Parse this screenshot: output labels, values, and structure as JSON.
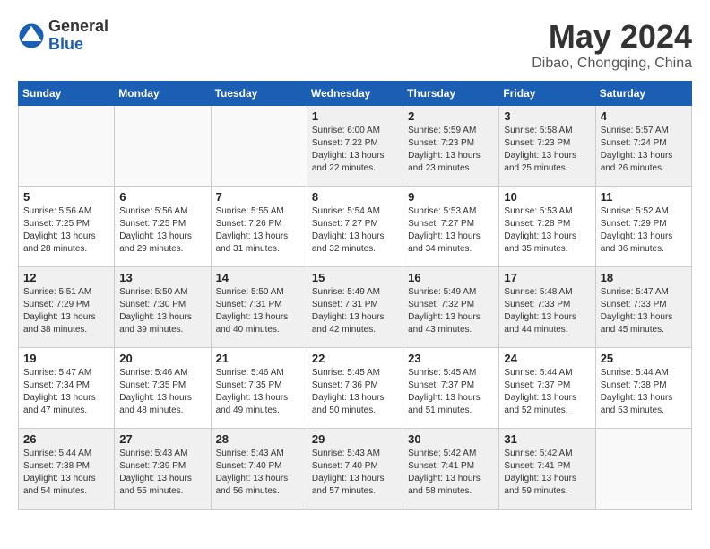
{
  "header": {
    "logo_general": "General",
    "logo_blue": "Blue",
    "month_year": "May 2024",
    "location": "Dibao, Chongqing, China"
  },
  "weekdays": [
    "Sunday",
    "Monday",
    "Tuesday",
    "Wednesday",
    "Thursday",
    "Friday",
    "Saturday"
  ],
  "weeks": [
    [
      {
        "day": "",
        "info": ""
      },
      {
        "day": "",
        "info": ""
      },
      {
        "day": "",
        "info": ""
      },
      {
        "day": "1",
        "info": "Sunrise: 6:00 AM\nSunset: 7:22 PM\nDaylight: 13 hours\nand 22 minutes."
      },
      {
        "day": "2",
        "info": "Sunrise: 5:59 AM\nSunset: 7:23 PM\nDaylight: 13 hours\nand 23 minutes."
      },
      {
        "day": "3",
        "info": "Sunrise: 5:58 AM\nSunset: 7:23 PM\nDaylight: 13 hours\nand 25 minutes."
      },
      {
        "day": "4",
        "info": "Sunrise: 5:57 AM\nSunset: 7:24 PM\nDaylight: 13 hours\nand 26 minutes."
      }
    ],
    [
      {
        "day": "5",
        "info": "Sunrise: 5:56 AM\nSunset: 7:25 PM\nDaylight: 13 hours\nand 28 minutes."
      },
      {
        "day": "6",
        "info": "Sunrise: 5:56 AM\nSunset: 7:25 PM\nDaylight: 13 hours\nand 29 minutes."
      },
      {
        "day": "7",
        "info": "Sunrise: 5:55 AM\nSunset: 7:26 PM\nDaylight: 13 hours\nand 31 minutes."
      },
      {
        "day": "8",
        "info": "Sunrise: 5:54 AM\nSunset: 7:27 PM\nDaylight: 13 hours\nand 32 minutes."
      },
      {
        "day": "9",
        "info": "Sunrise: 5:53 AM\nSunset: 7:27 PM\nDaylight: 13 hours\nand 34 minutes."
      },
      {
        "day": "10",
        "info": "Sunrise: 5:53 AM\nSunset: 7:28 PM\nDaylight: 13 hours\nand 35 minutes."
      },
      {
        "day": "11",
        "info": "Sunrise: 5:52 AM\nSunset: 7:29 PM\nDaylight: 13 hours\nand 36 minutes."
      }
    ],
    [
      {
        "day": "12",
        "info": "Sunrise: 5:51 AM\nSunset: 7:29 PM\nDaylight: 13 hours\nand 38 minutes."
      },
      {
        "day": "13",
        "info": "Sunrise: 5:50 AM\nSunset: 7:30 PM\nDaylight: 13 hours\nand 39 minutes."
      },
      {
        "day": "14",
        "info": "Sunrise: 5:50 AM\nSunset: 7:31 PM\nDaylight: 13 hours\nand 40 minutes."
      },
      {
        "day": "15",
        "info": "Sunrise: 5:49 AM\nSunset: 7:31 PM\nDaylight: 13 hours\nand 42 minutes."
      },
      {
        "day": "16",
        "info": "Sunrise: 5:49 AM\nSunset: 7:32 PM\nDaylight: 13 hours\nand 43 minutes."
      },
      {
        "day": "17",
        "info": "Sunrise: 5:48 AM\nSunset: 7:33 PM\nDaylight: 13 hours\nand 44 minutes."
      },
      {
        "day": "18",
        "info": "Sunrise: 5:47 AM\nSunset: 7:33 PM\nDaylight: 13 hours\nand 45 minutes."
      }
    ],
    [
      {
        "day": "19",
        "info": "Sunrise: 5:47 AM\nSunset: 7:34 PM\nDaylight: 13 hours\nand 47 minutes."
      },
      {
        "day": "20",
        "info": "Sunrise: 5:46 AM\nSunset: 7:35 PM\nDaylight: 13 hours\nand 48 minutes."
      },
      {
        "day": "21",
        "info": "Sunrise: 5:46 AM\nSunset: 7:35 PM\nDaylight: 13 hours\nand 49 minutes."
      },
      {
        "day": "22",
        "info": "Sunrise: 5:45 AM\nSunset: 7:36 PM\nDaylight: 13 hours\nand 50 minutes."
      },
      {
        "day": "23",
        "info": "Sunrise: 5:45 AM\nSunset: 7:37 PM\nDaylight: 13 hours\nand 51 minutes."
      },
      {
        "day": "24",
        "info": "Sunrise: 5:44 AM\nSunset: 7:37 PM\nDaylight: 13 hours\nand 52 minutes."
      },
      {
        "day": "25",
        "info": "Sunrise: 5:44 AM\nSunset: 7:38 PM\nDaylight: 13 hours\nand 53 minutes."
      }
    ],
    [
      {
        "day": "26",
        "info": "Sunrise: 5:44 AM\nSunset: 7:38 PM\nDaylight: 13 hours\nand 54 minutes."
      },
      {
        "day": "27",
        "info": "Sunrise: 5:43 AM\nSunset: 7:39 PM\nDaylight: 13 hours\nand 55 minutes."
      },
      {
        "day": "28",
        "info": "Sunrise: 5:43 AM\nSunset: 7:40 PM\nDaylight: 13 hours\nand 56 minutes."
      },
      {
        "day": "29",
        "info": "Sunrise: 5:43 AM\nSunset: 7:40 PM\nDaylight: 13 hours\nand 57 minutes."
      },
      {
        "day": "30",
        "info": "Sunrise: 5:42 AM\nSunset: 7:41 PM\nDaylight: 13 hours\nand 58 minutes."
      },
      {
        "day": "31",
        "info": "Sunrise: 5:42 AM\nSunset: 7:41 PM\nDaylight: 13 hours\nand 59 minutes."
      },
      {
        "day": "",
        "info": ""
      }
    ]
  ]
}
